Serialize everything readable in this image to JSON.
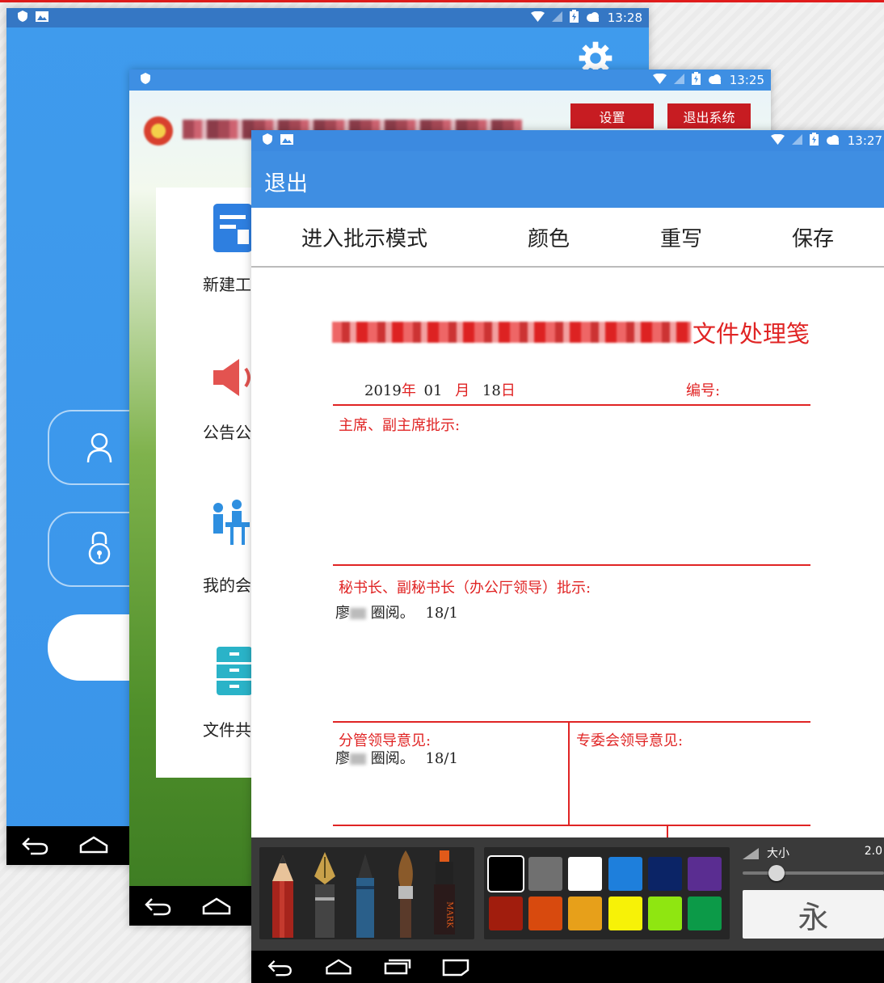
{
  "screen1": {
    "status_time": "13:28",
    "icons": [
      "shield-icon",
      "image-icon",
      "wifi-icon",
      "no-sim-icon",
      "battery-icon",
      "cloud-icon",
      "gear-icon",
      "user-icon",
      "lock-icon",
      "back-icon",
      "home-icon"
    ]
  },
  "screen2": {
    "status_time": "13:25",
    "buttons": {
      "settings": "设置",
      "logout": "退出系统"
    },
    "menu": [
      {
        "label": "新建工",
        "icon": "form-icon"
      },
      {
        "label": "公告公",
        "icon": "speaker-icon"
      },
      {
        "label": "我的会",
        "icon": "meeting-icon"
      },
      {
        "label": "文件共",
        "icon": "cabinet-icon"
      }
    ]
  },
  "screen3": {
    "status_time": "13:27",
    "appbar_title": "退出",
    "toolbar": {
      "annotate": "进入批示模式",
      "color": "颜色",
      "rewrite": "重写",
      "save": "保存"
    },
    "doc": {
      "title_suffix": "文件处理笺",
      "date_year": "2019",
      "nian": "年",
      "date_month": "01",
      "yue": "月",
      "date_day": "18",
      "ri": "日",
      "number_label": "编号:",
      "section1": "主席、副主席批示:",
      "section2": "秘书长、副秘书长（办公厅领导）批示:",
      "note_name": "廖",
      "note_text": "圈阅。",
      "note_date": "18/1",
      "section3": "分管领导意见:",
      "section4": "专委会领导意见:"
    },
    "palette": {
      "size_label": "大小",
      "size_value": "2.0",
      "preview_char": "永",
      "pen_marker_text": "MARK",
      "colors": [
        "#000000",
        "#707070",
        "#ffffff",
        "#1e7fdc",
        "#0b2466",
        "#5a2d91",
        "#a11d0d",
        "#d84a0e",
        "#e7a01a",
        "#f7f207",
        "#8fe611",
        "#0c9a48"
      ],
      "selected_color": "#000000"
    }
  }
}
